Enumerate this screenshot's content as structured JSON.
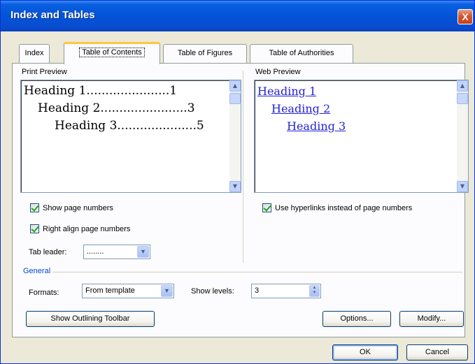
{
  "window": {
    "title": "Index and Tables",
    "close_label": "X"
  },
  "tabs": [
    {
      "label": "Index",
      "active": false
    },
    {
      "label": "Table of Contents",
      "active": true
    },
    {
      "label": "Table of Figures",
      "active": false
    },
    {
      "label": "Table of Authorities",
      "active": false
    }
  ],
  "print_preview": {
    "label": "Print Preview",
    "lines": [
      {
        "text": "Heading 1",
        "dots": "......................",
        "page": "1"
      },
      {
        "text": "Heading 2",
        "dots": ".......................",
        "page": "3"
      },
      {
        "text": "Heading 3",
        "dots": ".....................",
        "page": "5"
      }
    ]
  },
  "web_preview": {
    "label": "Web Preview",
    "links": [
      "Heading 1",
      "Heading 2",
      "Heading 3"
    ]
  },
  "options": {
    "show_page_numbers": {
      "label": "Show page numbers",
      "checked": true
    },
    "right_align": {
      "label": "Right align page numbers",
      "checked": true
    },
    "use_hyperlinks": {
      "label": "Use hyperlinks instead of page numbers",
      "checked": true
    },
    "tab_leader": {
      "label": "Tab leader:",
      "value": "........"
    }
  },
  "general": {
    "label": "General",
    "formats_label": "Formats:",
    "formats_value": "From template",
    "show_levels_label": "Show levels:",
    "show_levels_value": "3"
  },
  "buttons": {
    "outlining": "Show Outlining Toolbar",
    "options": "Options...",
    "modify": "Modify...",
    "ok": "OK",
    "cancel": "Cancel"
  },
  "icons": {
    "scroll_up": "▲",
    "scroll_down": "▼",
    "combo_arrow": "▼"
  }
}
